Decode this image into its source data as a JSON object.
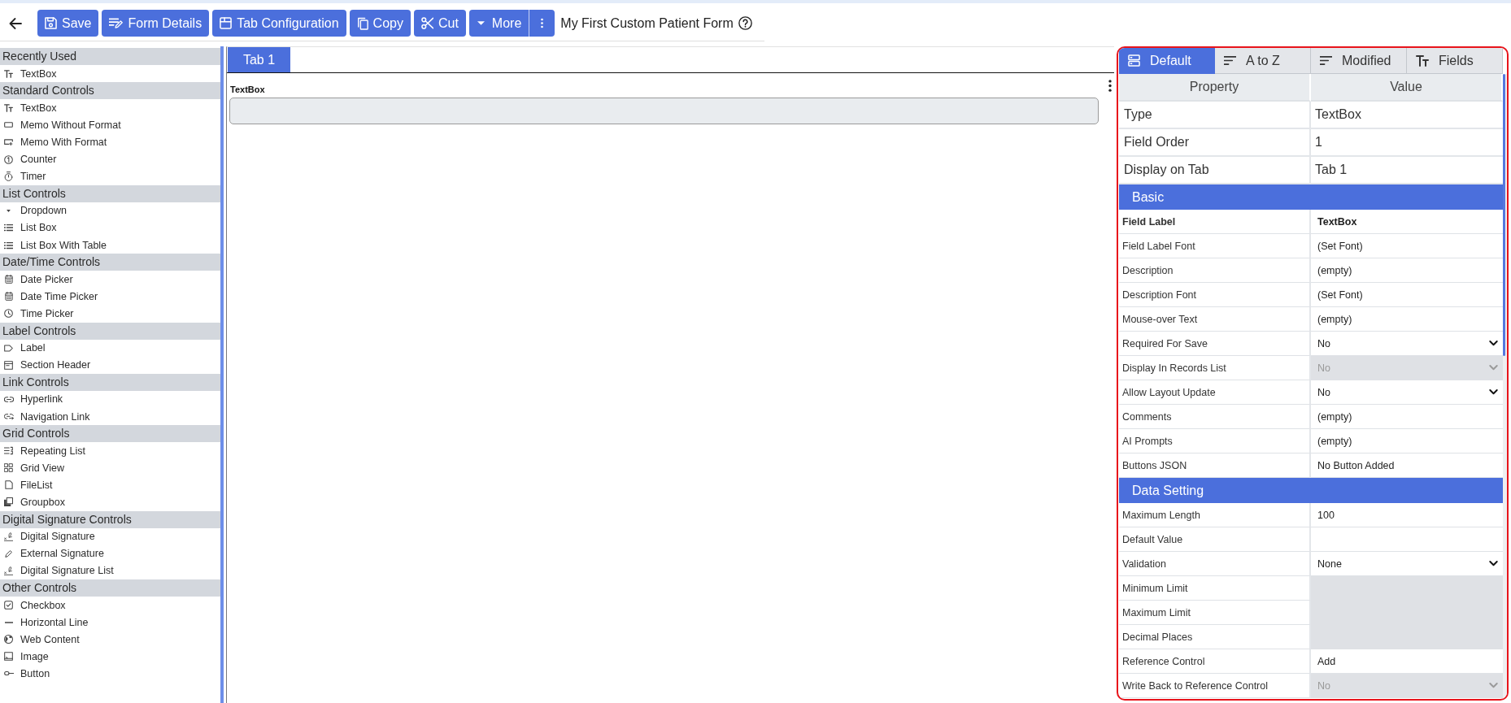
{
  "toolbar": {
    "buttons": [
      {
        "label": "Save",
        "kind": "save"
      },
      {
        "label": "Form Details",
        "kind": "details"
      },
      {
        "label": "Tab Configuration",
        "kind": "tabs"
      },
      {
        "label": "Copy",
        "kind": "copy"
      },
      {
        "label": "Cut",
        "kind": "cut"
      },
      {
        "label": "More",
        "kind": "more"
      }
    ],
    "form_title": "My First Custom Patient Form"
  },
  "palette": {
    "groups": [
      {
        "title": "Recently Used",
        "items": [
          {
            "label": "TextBox",
            "kind": "textbox"
          }
        ]
      },
      {
        "title": "Standard Controls",
        "items": [
          {
            "label": "TextBox",
            "kind": "textbox"
          },
          {
            "label": "Memo Without Format",
            "kind": "memo"
          },
          {
            "label": "Memo With Format",
            "kind": "richmemo"
          },
          {
            "label": "Counter",
            "kind": "counter"
          },
          {
            "label": "Timer",
            "kind": "timer"
          }
        ]
      },
      {
        "title": "List Controls",
        "items": [
          {
            "label": "Dropdown",
            "kind": "dropdown"
          },
          {
            "label": "List Box",
            "kind": "listbox"
          },
          {
            "label": "List Box With Table",
            "kind": "listbox"
          }
        ]
      },
      {
        "title": "Date/Time Controls",
        "items": [
          {
            "label": "Date Picker",
            "kind": "date"
          },
          {
            "label": "Date Time Picker",
            "kind": "date"
          },
          {
            "label": "Time Picker",
            "kind": "time"
          }
        ]
      },
      {
        "title": "Label Controls",
        "items": [
          {
            "label": "Label",
            "kind": "label"
          },
          {
            "label": "Section Header",
            "kind": "header"
          }
        ]
      },
      {
        "title": "Link Controls",
        "items": [
          {
            "label": "Hyperlink",
            "kind": "hyperlink"
          },
          {
            "label": "Navigation Link",
            "kind": "navlink"
          }
        ]
      },
      {
        "title": "Grid Controls",
        "items": [
          {
            "label": "Repeating List",
            "kind": "repeater"
          },
          {
            "label": "Grid View",
            "kind": "grid"
          },
          {
            "label": "FileList",
            "kind": "file"
          },
          {
            "label": "Groupbox",
            "kind": "groupbox"
          }
        ]
      },
      {
        "title": "Digital Signature Controls",
        "items": [
          {
            "label": "Digital Signature",
            "kind": "signature"
          },
          {
            "label": "External Signature",
            "kind": "pen"
          },
          {
            "label": "Digital Signature List",
            "kind": "signature"
          }
        ]
      },
      {
        "title": "Other Controls",
        "items": [
          {
            "label": "Checkbox",
            "kind": "checkbox"
          },
          {
            "label": "Horizontal Line",
            "kind": "line"
          },
          {
            "label": "Web Content",
            "kind": "web"
          },
          {
            "label": "Image",
            "kind": "image"
          },
          {
            "label": "Button",
            "kind": "button"
          }
        ]
      }
    ]
  },
  "canvas": {
    "tabs": [
      {
        "label": "Tab 1",
        "selected": true
      }
    ],
    "fields": [
      {
        "label": "TextBox"
      }
    ]
  },
  "properties": {
    "tabs": [
      {
        "label": "Default",
        "kind": "default",
        "selected": true
      },
      {
        "label": "A to Z",
        "kind": "sort",
        "selected": false
      },
      {
        "label": "Modified",
        "kind": "sort",
        "selected": false
      },
      {
        "label": "Fields",
        "kind": "fields",
        "selected": false
      }
    ],
    "columns": [
      "Property",
      "Value"
    ],
    "rows": [
      {
        "kind": "info",
        "property": "Type",
        "value": "TextBox",
        "bold": false,
        "disabled": false
      },
      {
        "kind": "info",
        "property": "Field Order",
        "value": "1",
        "bold": false,
        "disabled": false
      },
      {
        "kind": "info",
        "property": "Display on Tab",
        "value": "Tab 1",
        "bold": false,
        "disabled": false
      },
      {
        "kind": "section",
        "title": "Basic"
      },
      {
        "kind": "text",
        "property": "Field Label",
        "value": "TextBox",
        "bold": true,
        "disabled": false
      },
      {
        "kind": "text",
        "property": "Field Label Font",
        "value": "(Set Font)",
        "bold": false,
        "disabled": false
      },
      {
        "kind": "text",
        "property": "Description",
        "value": "(empty)",
        "bold": false,
        "disabled": false
      },
      {
        "kind": "text",
        "property": "Description Font",
        "value": "(Set Font)",
        "bold": false,
        "disabled": false
      },
      {
        "kind": "text",
        "property": "Mouse-over Text",
        "value": "(empty)",
        "bold": false,
        "disabled": false
      },
      {
        "kind": "select",
        "property": "Required For Save",
        "value": "No",
        "bold": false,
        "disabled": false
      },
      {
        "kind": "select",
        "property": "Display In Records List",
        "value": "No",
        "bold": false,
        "disabled": true
      },
      {
        "kind": "select",
        "property": "Allow Layout Update",
        "value": "No",
        "bold": false,
        "disabled": false
      },
      {
        "kind": "text",
        "property": "Comments",
        "value": "(empty)",
        "bold": false,
        "disabled": false
      },
      {
        "kind": "text",
        "property": "AI Prompts",
        "value": "(empty)",
        "bold": false,
        "disabled": false
      },
      {
        "kind": "text",
        "property": "Buttons JSON",
        "value": "No Button Added",
        "bold": false,
        "disabled": false
      },
      {
        "kind": "section",
        "title": "Data Setting"
      },
      {
        "kind": "text",
        "property": "Maximum Length",
        "value": "100",
        "bold": false,
        "disabled": false
      },
      {
        "kind": "text",
        "property": "Default Value",
        "bold": false,
        "disabled": false
      },
      {
        "kind": "select",
        "property": "Validation",
        "value": "None",
        "bold": false,
        "disabled": false
      },
      {
        "kind": "text",
        "property": "Minimum Limit",
        "bold": false,
        "disabled": true
      },
      {
        "kind": "text",
        "property": "Maximum Limit",
        "bold": false,
        "disabled": true
      },
      {
        "kind": "text",
        "property": "Decimal Places",
        "bold": false,
        "disabled": true
      },
      {
        "kind": "text",
        "property": "Reference Control",
        "value": "Add",
        "bold": false,
        "disabled": false
      },
      {
        "kind": "select",
        "property": "Write Back to Reference Control",
        "value": "No",
        "bold": false,
        "disabled": true
      }
    ]
  }
}
